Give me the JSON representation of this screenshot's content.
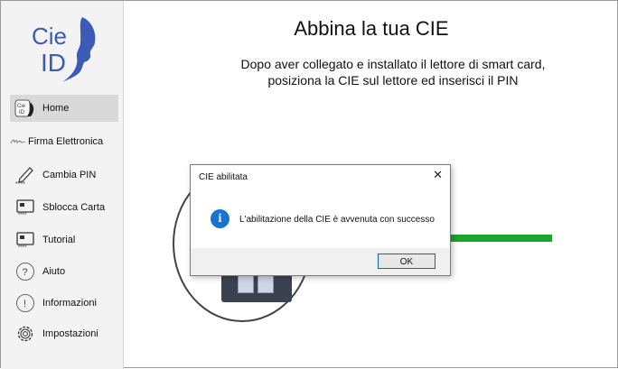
{
  "sidebar": {
    "logo_text": "Cie ID",
    "items": [
      {
        "label": "Home"
      },
      {
        "label": "Firma Elettronica"
      },
      {
        "label": "Cambia PIN"
      },
      {
        "label": "Sblocca Carta"
      },
      {
        "label": "Tutorial"
      },
      {
        "label": "Aiuto"
      },
      {
        "label": "Informazioni"
      },
      {
        "label": "Impostazioni"
      }
    ],
    "icons": [
      "home-card-icon",
      "signature-icon",
      "pen-pin-icon",
      "card-unlock-icon",
      "tutorial-icon",
      "help-icon",
      "info-icon",
      "gear-icon"
    ]
  },
  "main": {
    "title": "Abbina la tua CIE",
    "subtitle": "Dopo aver collegato e installato il lettore di smart card, posiziona la CIE sul lettore ed inserisci il PIN"
  },
  "dialog": {
    "title": "CIE abilitata",
    "close_glyph": "✕",
    "info_glyph": "i",
    "message": "L'abilitazione della CIE è avvenuta con successo",
    "ok_label": "OK"
  },
  "colors": {
    "accent_blue": "#3b5bb6",
    "progress_green": "#1aa52e",
    "info_blue": "#1a73d1"
  },
  "progress": {
    "fraction": 1.0
  }
}
